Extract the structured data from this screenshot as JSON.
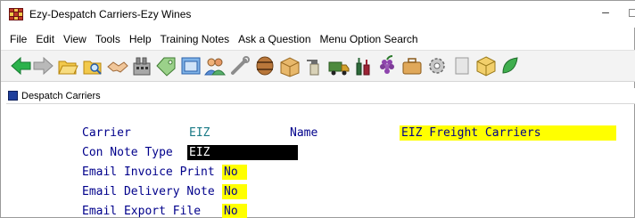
{
  "window": {
    "title": "Ezy-Despatch Carriers-Ezy Wines",
    "minimize_glyph": "–"
  },
  "menu": [
    "File",
    "Edit",
    "View",
    "Tools",
    "Help",
    "Training Notes",
    "Ask a Question",
    "Menu Option Search"
  ],
  "toolbar": {
    "icons": [
      "back-arrow-icon",
      "forward-arrow-icon",
      "folder-open-icon",
      "folder-search-icon",
      "handshake-icon",
      "factory-icon",
      "money-tag-icon",
      "window-frame-icon",
      "users-icon",
      "wrench-icon",
      "barrel-icon",
      "box-icon",
      "spray-bottle-icon",
      "truck-icon",
      "bottles-icon",
      "grapes-icon",
      "briefcase-icon",
      "gear-icon",
      "blank-page-icon",
      "cube-icon",
      "leaf-icon"
    ]
  },
  "form_window": {
    "title": "Despatch Carriers"
  },
  "form": {
    "carrier_label": "Carrier",
    "carrier_value": "EIZ",
    "name_label": "Name",
    "name_value": "EIZ Freight Carriers",
    "con_note_type_label": "Con Note Type",
    "con_note_type_value": "EIZ",
    "email_invoice_print_label": "Email Invoice Print",
    "email_invoice_print_value": "No",
    "email_delivery_note_label": "Email Delivery Note",
    "email_delivery_note_value": "No",
    "email_export_file_label": "Email Export File",
    "email_export_file_value": "No"
  },
  "colors": {
    "label": "#00008b",
    "carrier_value": "#1a7a86",
    "highlight": "#ffff00",
    "active_field_bg": "#000000"
  }
}
